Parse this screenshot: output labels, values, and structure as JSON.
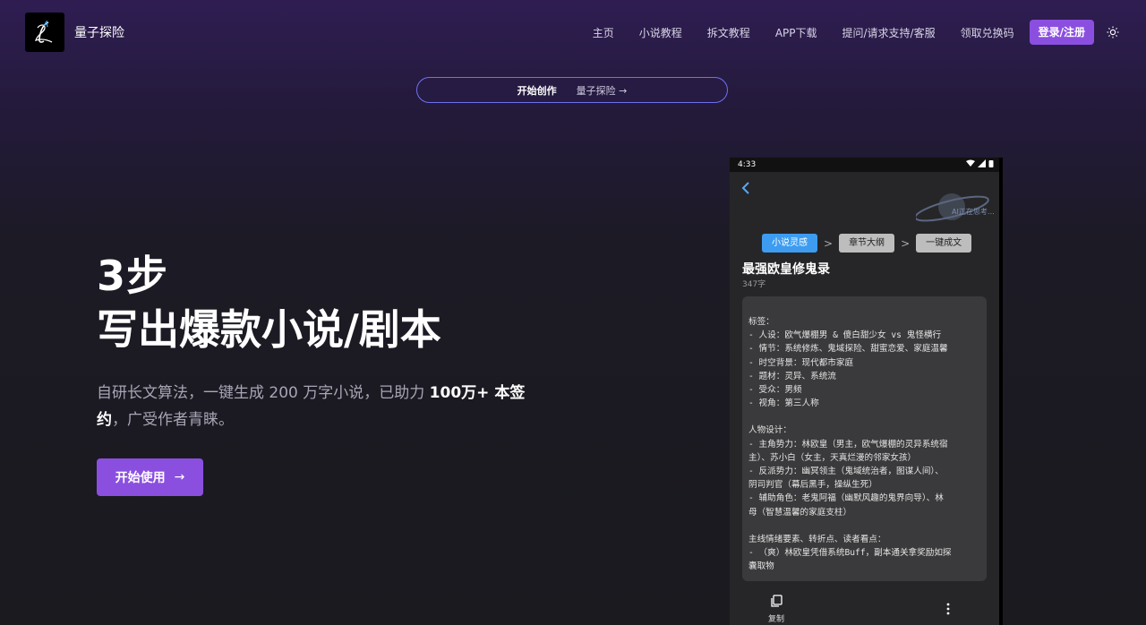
{
  "header": {
    "brand": "量子探险",
    "nav": [
      "主页",
      "小说教程",
      "拆文教程",
      "APP下载",
      "提问/请求支持/客服",
      "领取兑换码"
    ],
    "login_label": "登录/注册",
    "theme_icon": "sun-icon"
  },
  "announcement": {
    "strong": "开始创作",
    "link": "量子探险 →"
  },
  "hero": {
    "line1": "3步",
    "line2": "写出爆款小说/剧本",
    "desc_pre": "自研长文算法，一键生成 200 万字小说，已助力 ",
    "desc_bold1": "100万+ 本签约",
    "desc_post": "，广受作者青睐。",
    "button_label": "开始使用",
    "button_arrow": "→"
  },
  "phone": {
    "time": "4:33",
    "status_icons": "▾◢ ▮",
    "ai_text": "AI正在思考…",
    "steps": [
      "小说灵感",
      "章节大纲",
      "一键成文"
    ],
    "step_sep": ">",
    "title": "最强欧皇修鬼录",
    "word_count": "347字",
    "lines": [
      "标签：",
      "- 人设：欧气爆棚男 & 傻白甜少女 vs 鬼怪横行",
      "- 情节：系统修炼、鬼域探险、甜蜜恋爱、家庭温馨",
      "- 时空背景：现代都市家庭",
      "- 题材：灵异、系统流",
      "- 受众：男频",
      "- 视角：第三人称",
      "",
      "人物设计：",
      "- 主角势力：林欧皇（男主，欧气爆棚的灵异系统宿",
      "主）、苏小白（女主，天真烂漫的邻家女孩）",
      "- 反派势力：幽冥领主（鬼域统治者，图谋人间）、",
      "阴司判官（幕后黑手，操纵生死）",
      "- 辅助角色：老鬼阿福（幽默风趣的鬼界向导）、林",
      "母（智慧温馨的家庭支柱）",
      "",
      "主线情绪要素、转折点、读者看点：",
      "- （爽）林欧皇凭借系统Buff，副本通关拿奖励如探",
      "囊取物"
    ],
    "copy_label": "复制"
  }
}
